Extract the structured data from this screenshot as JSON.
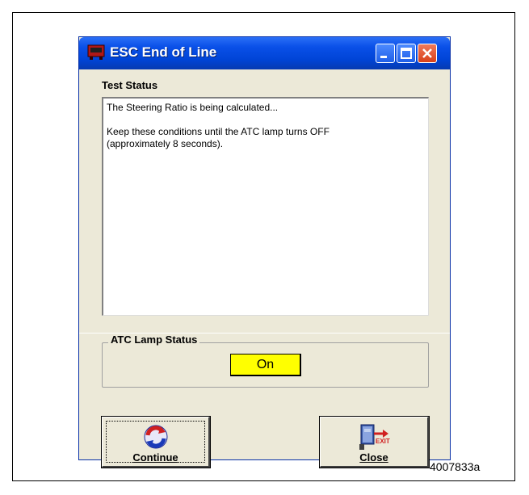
{
  "window": {
    "title": "ESC End of Line",
    "titlebar_color": "#0a50e8",
    "body_color": "#ece9d8"
  },
  "test_status": {
    "label": "Test Status",
    "line1": "The Steering Ratio is being calculated...",
    "line2": "Keep these conditions until the ATC lamp turns OFF\n(approximately 8 seconds)."
  },
  "atc_lamp": {
    "label": "ATC Lamp Status",
    "value": "On",
    "indicator_color": "#ffff00"
  },
  "buttons": {
    "continue_label": "Continue",
    "continue_icon": "refresh-icon",
    "close_label": "Close",
    "close_icon": "exit-door-icon",
    "exit_text": "EXIT"
  },
  "figure_ref": "4007833a"
}
